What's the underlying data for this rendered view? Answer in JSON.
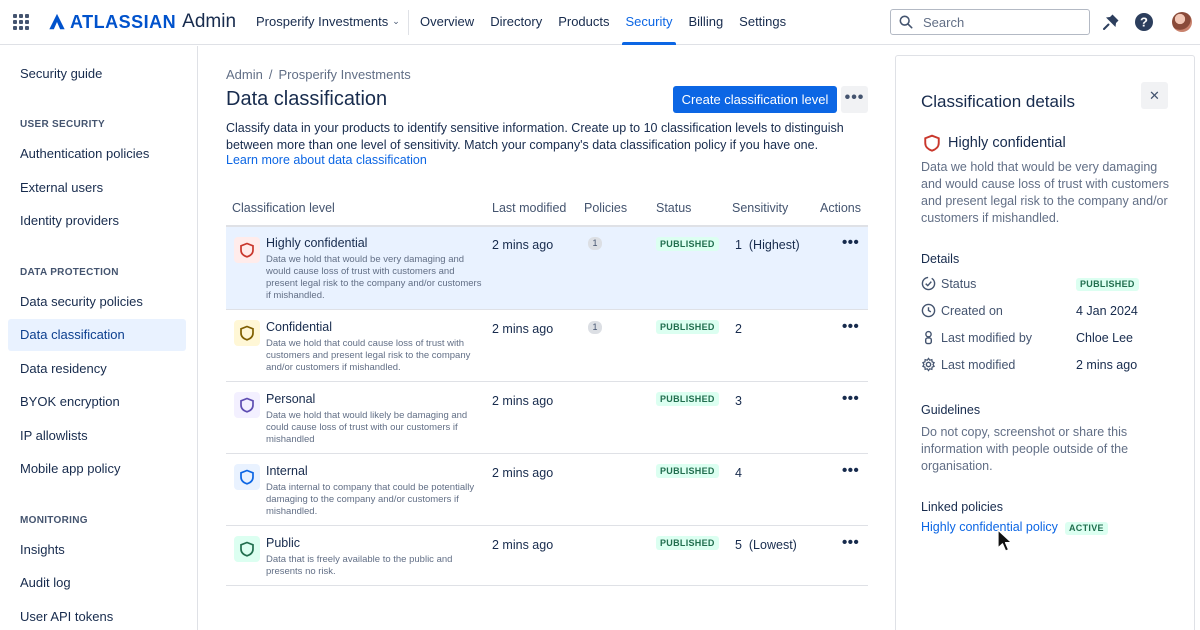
{
  "app": {
    "brand": "ATLASSIAN",
    "product": "Admin",
    "org": "Prosperify Investments",
    "nav": [
      "Overview",
      "Directory",
      "Products",
      "Security",
      "Billing",
      "Settings"
    ],
    "active_nav": "Security",
    "search_placeholder": "Search",
    "brand_color": "#0052cc",
    "accent_color": "#0c66e4"
  },
  "sidebar": {
    "top_item": "Security guide",
    "sections": [
      {
        "heading": "USER SECURITY",
        "items": [
          "Authentication policies",
          "External users",
          "Identity providers"
        ]
      },
      {
        "heading": "DATA PROTECTION",
        "items": [
          "Data security policies",
          "Data classification",
          "Data residency",
          "BYOK encryption",
          "IP allowlists",
          "Mobile app policy"
        ]
      },
      {
        "heading": "MONITORING",
        "items": [
          "Insights",
          "Audit log",
          "User API tokens"
        ]
      }
    ],
    "active_item": "Data classification"
  },
  "main": {
    "breadcrumb": [
      "Admin",
      "Prosperify Investments"
    ],
    "breadcrumb_sep": "/",
    "title": "Data classification",
    "create_button": "Create classification level",
    "more_button": "•••",
    "description": "Classify data in your products to identify sensitive information. Create up to 10 classification levels to distinguish between more than one level of sensitivity. Match your company's data classification policy if you have one.",
    "learn_more": "Learn more about data classification",
    "table": {
      "columns": [
        "Classification level",
        "Last modified",
        "Policies",
        "Status",
        "Sensitivity",
        "Actions"
      ],
      "rows": [
        {
          "name": "Highly confidential",
          "description": "Data we hold that would be very damaging and would cause loss of trust with customers and present legal risk to the company and/or customers if mishandled.",
          "modified": "2 mins ago",
          "policies": "1",
          "status": "PUBLISHED",
          "sensitivity": "1  (Highest)",
          "actions": "•••",
          "color": "#c9372c",
          "bg": "#ffeceb",
          "selected": true
        },
        {
          "name": "Confidential",
          "description": "Data we hold that could cause loss of trust with customers and present legal risk to the company and/or customers if mishandled.",
          "modified": "2 mins ago",
          "policies": "1",
          "status": "PUBLISHED",
          "sensitivity": "2",
          "actions": "•••",
          "color": "#7f5f01",
          "bg": "#fff7d6",
          "selected": false
        },
        {
          "name": "Personal",
          "description": "Data we hold that would likely be damaging and could cause loss of trust with our customers if mishandled",
          "modified": "2 mins ago",
          "policies": "",
          "status": "PUBLISHED",
          "sensitivity": "3",
          "actions": "•••",
          "color": "#5e4db2",
          "bg": "#f3f0ff",
          "selected": false
        },
        {
          "name": "Internal",
          "description": "Data internal to company that could be potentially damaging to the company and/or customers if mishandled.",
          "modified": "2 mins ago",
          "policies": "",
          "status": "PUBLISHED",
          "sensitivity": "4",
          "actions": "•••",
          "color": "#0c66e4",
          "bg": "#e9f2ff",
          "selected": false
        },
        {
          "name": "Public",
          "description": "Data that is freely available to the public and presents no risk.",
          "modified": "2 mins ago",
          "policies": "",
          "status": "PUBLISHED",
          "sensitivity": "5  (Lowest)",
          "actions": "•••",
          "color": "#216e4e",
          "bg": "#dcfff1",
          "selected": false
        }
      ]
    }
  },
  "panel": {
    "title": "Classification details",
    "close": "✕",
    "level_name": "Highly confidential",
    "level_description": "Data we hold that would be very damaging and would cause loss of trust with customers and present legal risk to the company and/or customers if mishandled.",
    "details_heading": "Details",
    "details": [
      {
        "label": "Status",
        "value": "PUBLISHED",
        "icon": "status-check-icon",
        "lozenge": true
      },
      {
        "label": "Created on",
        "value": "4 Jan 2024",
        "icon": "clock-icon",
        "lozenge": false
      },
      {
        "label": "Last modified by",
        "value": "Chloe Lee",
        "icon": "person-icon",
        "lozenge": false
      },
      {
        "label": "Last modified",
        "value": "2 mins ago",
        "icon": "gear-icon",
        "lozenge": false
      }
    ],
    "guidelines_heading": "Guidelines",
    "guidelines_text": "Do not copy, screenshot or share this information with people outside of the organisation.",
    "linked_heading": "Linked policies",
    "linked_policy": "Highly confidential policy",
    "linked_status": "ACTIVE"
  }
}
